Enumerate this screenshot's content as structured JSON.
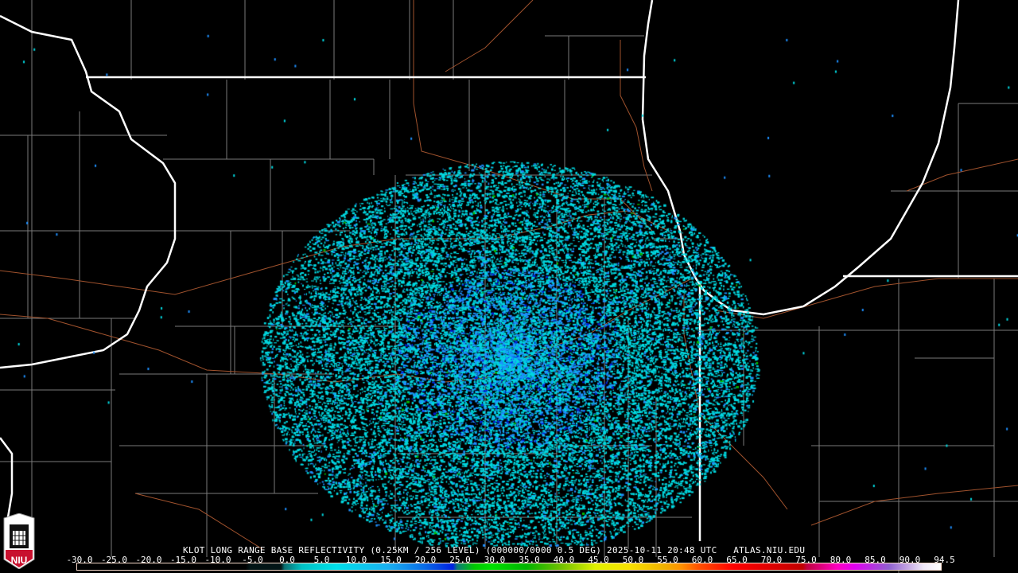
{
  "product": {
    "title": "KLOT LONG RANGE BASE REFLECTIVITY (0.25KM / 256 LEVEL) (000000/0000 0.5 DEG) 2025-10-11 20:48 UTC   ATLAS.NIU.EDU",
    "station": "KLOT",
    "elevation_deg": 0.5,
    "datetime": "2025-10-11 20:48 UTC",
    "source": "ATLAS.NIU.EDU"
  },
  "logo": {
    "text": "NIU",
    "icon": "niu-castle-logo-icon"
  },
  "legend": {
    "units": "dBZ",
    "labels": [
      "-30.0",
      "-25.0",
      "-20.0",
      "-15.0",
      "-10.0",
      "-5.0",
      "0.0",
      "5.0",
      "10.0",
      "15.0",
      "20.0",
      "25.0",
      "30.0",
      "35.0",
      "40.0",
      "45.0",
      "50.0",
      "55.0",
      "60.0",
      "65.0",
      "70.0",
      "75.0",
      "80.0",
      "85.0",
      "90.0",
      "94.5"
    ]
  },
  "colors": {
    "state_border": "#ffffff",
    "county_line": "#808080",
    "highway": "#a0522d",
    "echo_light": "#00d8e0",
    "echo_mid": "#1e90ff",
    "echo_strong": "#0020e0",
    "echo_green": "#00c000"
  }
}
